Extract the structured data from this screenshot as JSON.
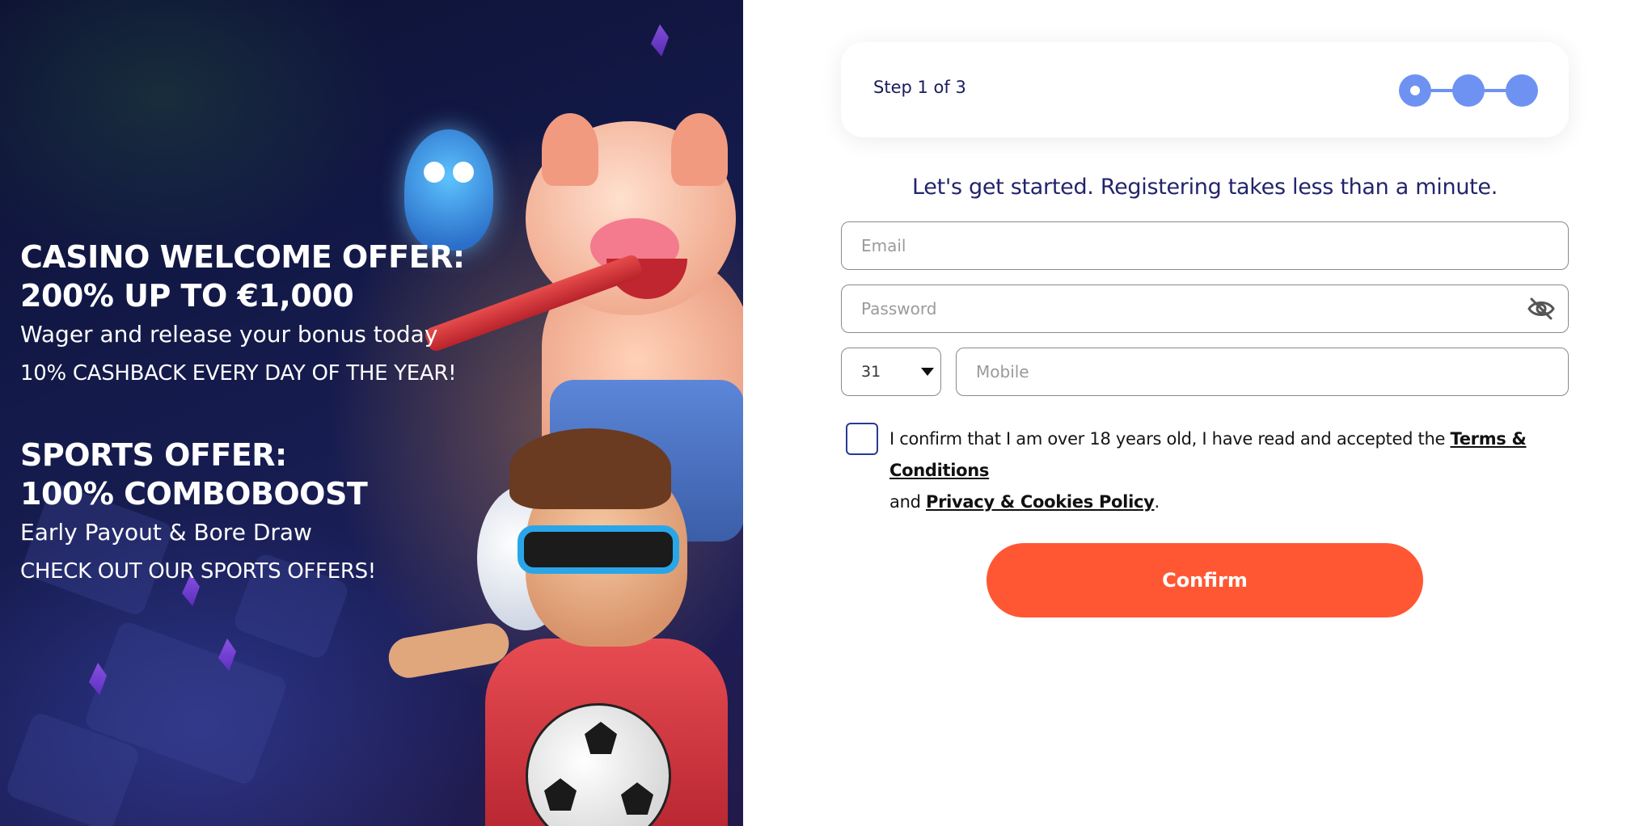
{
  "promo": {
    "casino_heading_line1": "CASINO WELCOME OFFER:",
    "casino_heading_line2": "200% UP TO €1,000",
    "casino_sub": "Wager and release your bonus today",
    "casino_cta": "10% CASHBACK EVERY DAY OF THE YEAR!",
    "sports_heading_line1": "SPORTS OFFER:",
    "sports_heading_line2": "100% COMBOBOOST",
    "sports_sub": "Early Payout & Bore Draw",
    "sports_cta": "CHECK OUT OUR SPORTS OFFERS!"
  },
  "stepper": {
    "label": "Step 1 of 3",
    "current_step": 1,
    "total_steps": 3,
    "color": "#6d92f2"
  },
  "form": {
    "heading": "Let's get started. Registering takes less than a minute.",
    "email_placeholder": "Email",
    "password_placeholder": "Password",
    "country_code": "31",
    "mobile_placeholder": "Mobile",
    "consent_prefix": "I confirm that I am over 18 years old, I have read and accepted the ",
    "terms_link": "Terms & Conditions",
    "consent_and": " and ",
    "privacy_link": "Privacy & Cookies Policy",
    "consent_suffix": ".",
    "confirm_label": "Confirm",
    "accent_color": "#ff5733"
  },
  "icons": {
    "password_toggle": "eye-off-icon",
    "select_caret": "caret-down-icon"
  }
}
